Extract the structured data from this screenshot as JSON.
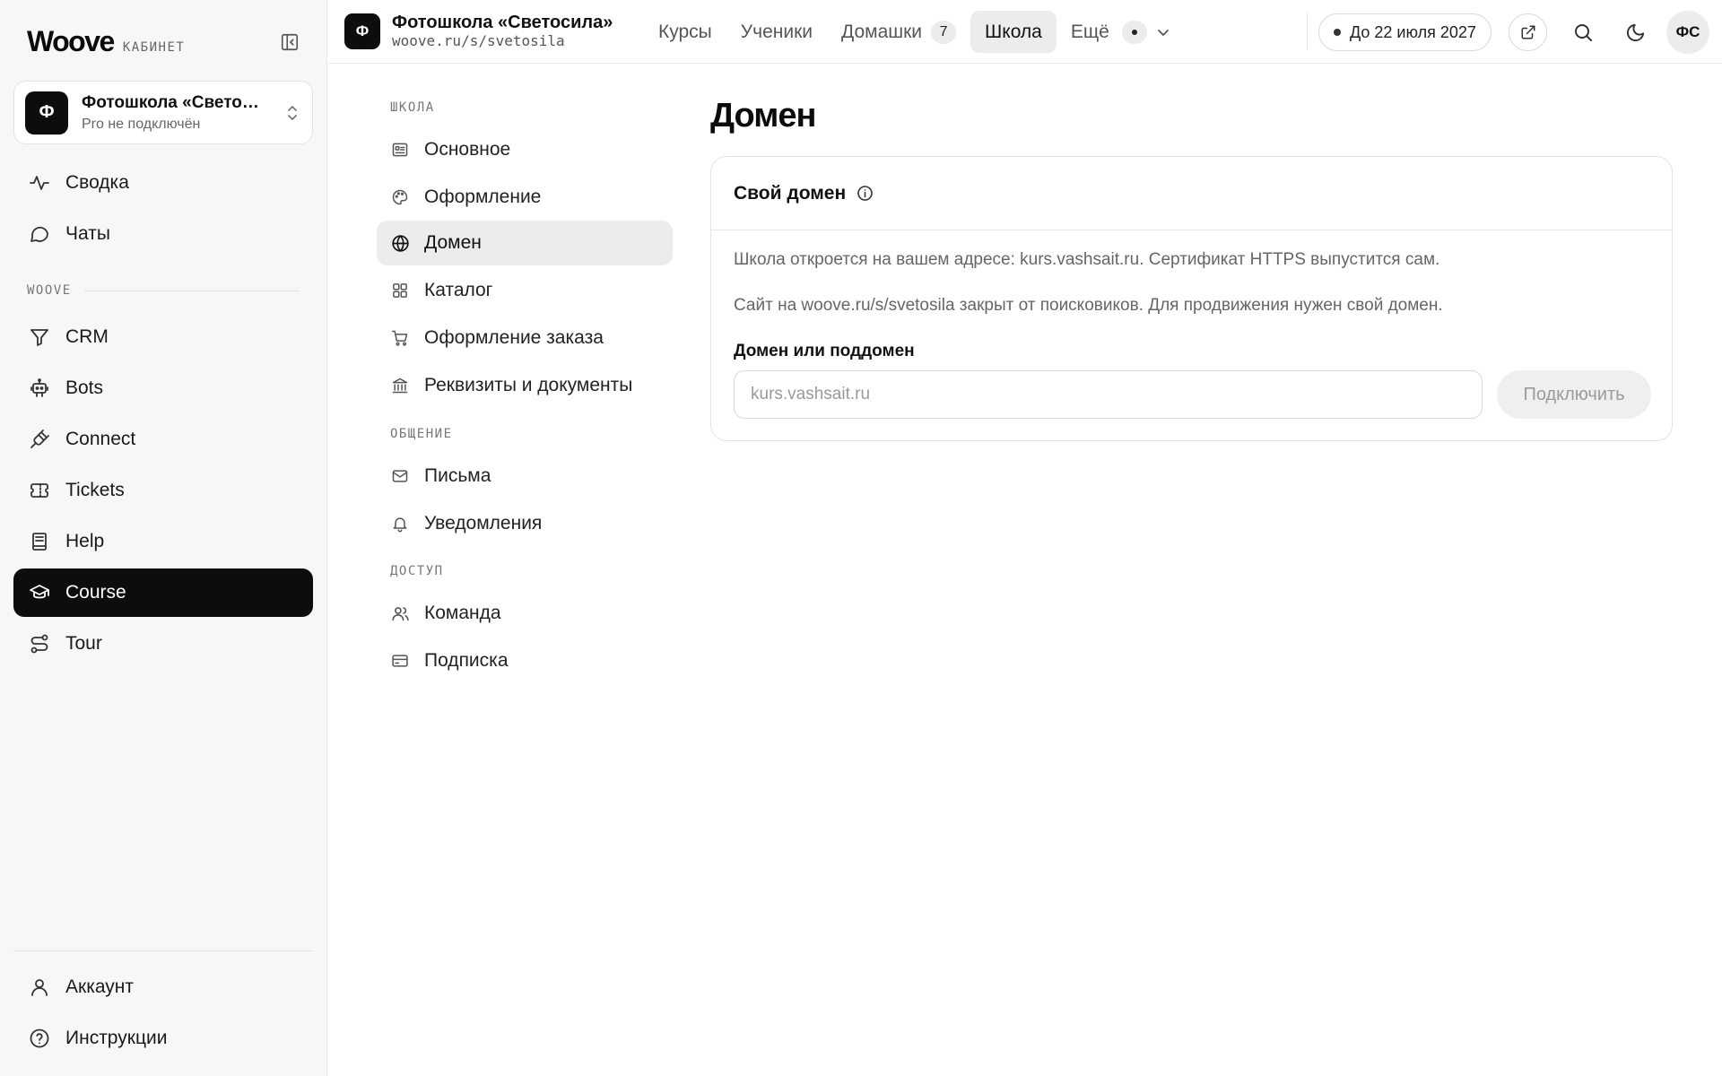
{
  "brand": {
    "logo": "Woove",
    "subtitle": "КАБИНЕТ"
  },
  "school": {
    "avatar_letter": "Ф",
    "name": "Фотошкола «Свето…",
    "plan": "Pro не подключён"
  },
  "sidebar": {
    "top_items": [
      {
        "label": "Сводка",
        "icon": "activity-icon"
      },
      {
        "label": "Чаты",
        "icon": "chat-bubble-icon"
      }
    ],
    "section_label": "WOOVE",
    "product_items": [
      {
        "label": "CRM",
        "icon": "funnel-icon"
      },
      {
        "label": "Bots",
        "icon": "robot-icon"
      },
      {
        "label": "Connect",
        "icon": "plug-icon"
      },
      {
        "label": "Tickets",
        "icon": "ticket-icon"
      },
      {
        "label": "Help",
        "icon": "book-icon"
      },
      {
        "label": "Course",
        "icon": "graduation-cap-icon",
        "active": true
      },
      {
        "label": "Tour",
        "icon": "route-icon"
      }
    ],
    "bottom_items": [
      {
        "label": "Аккаунт",
        "icon": "user-icon"
      },
      {
        "label": "Инструкции",
        "icon": "help-circle-icon"
      }
    ]
  },
  "topbar": {
    "school_avatar": "Ф",
    "school_name": "Фотошкола «Светосила»",
    "school_url": "woove.ru/s/svetosila",
    "tabs": [
      {
        "label": "Курсы"
      },
      {
        "label": "Ученики"
      },
      {
        "label": "Домашки",
        "badge": "7"
      },
      {
        "label": "Школа",
        "active": true
      },
      {
        "label": "Ещё"
      }
    ],
    "subscription": "До 22 июля 2027",
    "user_initials": "ФС"
  },
  "settings_nav": {
    "sections": [
      {
        "title": "ШКОЛА",
        "items": [
          {
            "label": "Основное",
            "icon": "id-card-icon"
          },
          {
            "label": "Оформление",
            "icon": "palette-icon"
          },
          {
            "label": "Домен",
            "icon": "globe-icon",
            "active": true
          },
          {
            "label": "Каталог",
            "icon": "grid-icon"
          },
          {
            "label": "Оформление заказа",
            "icon": "cart-icon"
          },
          {
            "label": "Реквизиты и документы",
            "icon": "bank-icon"
          }
        ]
      },
      {
        "title": "ОБЩЕНИЕ",
        "items": [
          {
            "label": "Письма",
            "icon": "mail-icon"
          },
          {
            "label": "Уведомления",
            "icon": "bell-icon"
          }
        ]
      },
      {
        "title": "ДОСТУП",
        "items": [
          {
            "label": "Команда",
            "icon": "users-icon"
          },
          {
            "label": "Подписка",
            "icon": "credit-card-icon"
          }
        ]
      }
    ]
  },
  "main": {
    "title": "Домен",
    "card": {
      "title": "Свой домен",
      "paragraph_1": "Школа откроется на вашем адресе: kurs.vashsait.ru. Сертификат HTTPS выпустится сам.",
      "paragraph_2": "Сайт на woove.ru/s/svetosila закрыт от поисковиков. Для продвижения нужен свой домен.",
      "field_label": "Домен или поддомен",
      "input_value": "",
      "input_placeholder": "kurs.vashsait.ru",
      "button_label": "Подключить"
    }
  },
  "colors": {
    "accent": "#0d0d0d",
    "active_bg": "#ececec",
    "sidebar_bg": "#f7f7f7",
    "muted_text": "#666666"
  }
}
